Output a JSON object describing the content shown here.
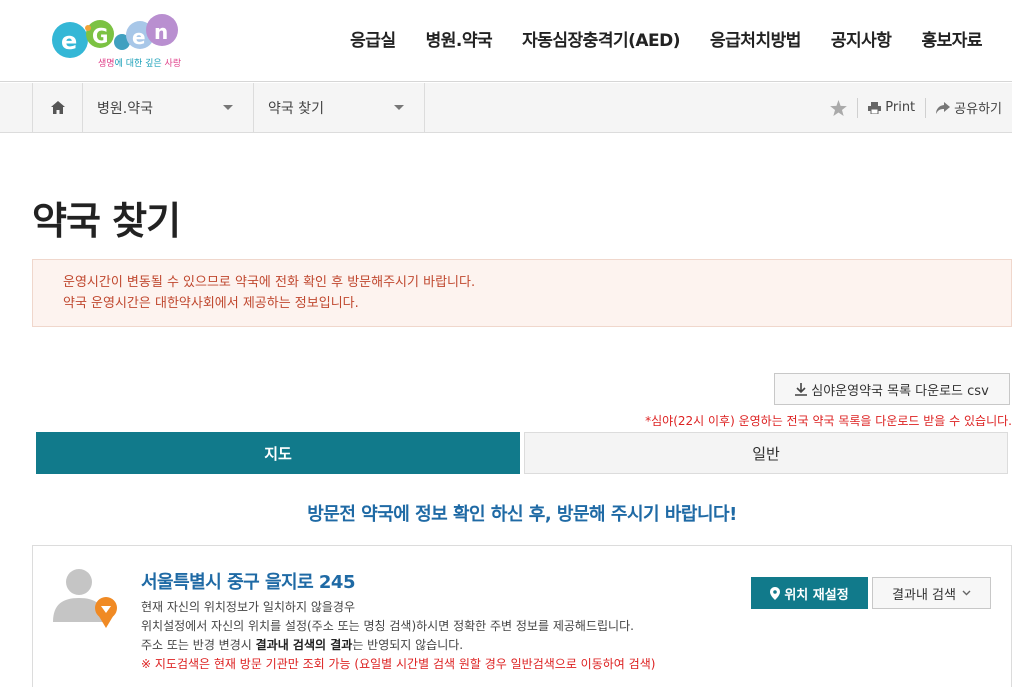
{
  "header": {
    "logo_text": "E-Gen",
    "logo_tagline_1": "생명",
    "logo_tagline_2": "에 대한 깊은 ",
    "logo_tagline_3": "사랑",
    "nav": [
      "응급실",
      "병원.약국",
      "자동심장충격기(AED)",
      "응급처치방법",
      "공지사항",
      "홍보자료"
    ]
  },
  "location_bar": {
    "home_icon": "home-icon",
    "dropdown_1": "병원.약국",
    "dropdown_2": "약국 찾기",
    "print_label": "Print",
    "share_label": "공유하기"
  },
  "page": {
    "title": "약국 찾기",
    "notice_line_1": "운영시간이 변동될 수 있으므로 약국에 전화 확인 후 방문해주시기 바랍니다.",
    "notice_line_2": "약국 운영시간은 대한약사회에서 제공하는 정보입니다.",
    "download_label": "심야운영약국 목록 다운로드 csv",
    "download_note": "*심야(22시 이후) 운영하는 전국 약국 목록을 다운로드 받을 수 있습니다.",
    "tabs": [
      "지도",
      "일반"
    ],
    "guide_text": "방문전 약국에 정보 확인 하신 후, 방문해 주시기 바랍니다!"
  },
  "location_box": {
    "address": "서울특별시 중구 을지로 245",
    "desc_1": "현재 자신의 위치정보가 일치하지 않을경우",
    "desc_2": "위치설정에서 자신의 위치를 설정(주소 또는 명칭 검색)하시면 정확한 주변 정보를 제공해드립니다.",
    "desc_3a": "주소 또는 반경 변경시 ",
    "desc_3b": "결과내 검색의 결과",
    "desc_3c": "는 반영되지 않습니다.",
    "desc_4": "※ 지도검색은 현재 방문 기관만 조회 가능 (요일별 시간별 검색 원할 경우 일반검색으로 이동하여 검색)",
    "reset_label": "위치 재설정",
    "search_label": "결과내 검색"
  },
  "colors": {
    "accent": "#117a8b",
    "link_blue": "#1f6aa5",
    "warning_red": "#d22222",
    "notice_bg": "#fdf3ef"
  }
}
